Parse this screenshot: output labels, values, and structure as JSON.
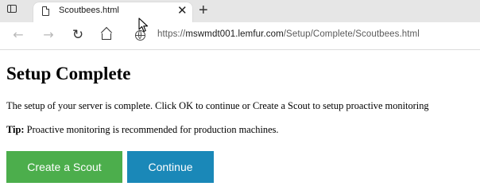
{
  "browser": {
    "tab": {
      "title": "Scoutbees.html",
      "close_glyph": "✕",
      "icon": "document-icon"
    },
    "new_tab_glyph": "+",
    "nav": {
      "back_glyph": "←",
      "forward_glyph": "→",
      "reload_glyph": "↻",
      "home_icon": "home-icon"
    },
    "address": {
      "scheme": "https://",
      "host": "mswmdt001.lemfur.com",
      "path": "/Setup/Complete/Scoutbees.html",
      "icon": "globe-icon"
    }
  },
  "page": {
    "title": "Setup Complete",
    "description": "The setup of your server is complete. Click OK to continue or Create a Scout to setup proactive monitoring",
    "tip": {
      "label": "Tip:",
      "text": " Proactive monitoring is recommended for production machines."
    },
    "buttons": {
      "create_scout": "Create a Scout",
      "continue": "Continue"
    }
  },
  "colors": {
    "create_scout_bg": "#4cae4c",
    "continue_bg": "#1a88b8",
    "tabstrip_bg": "#e6e6e6"
  }
}
